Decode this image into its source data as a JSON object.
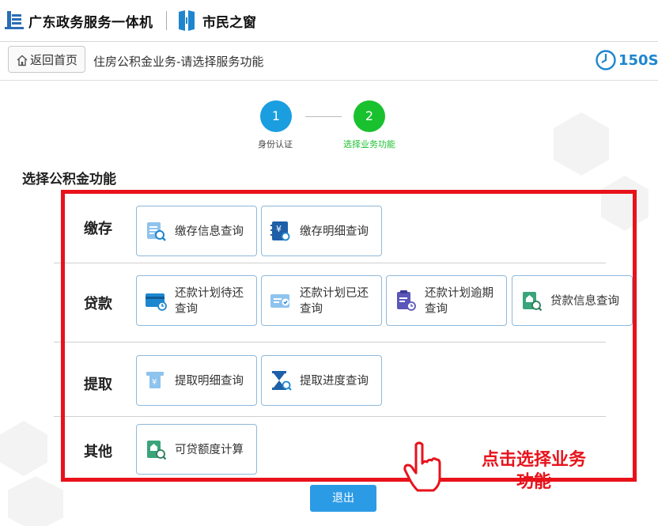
{
  "header": {
    "brand_primary": "广东政务服务一体机",
    "brand_secondary": "市民之窗"
  },
  "nav": {
    "back_label": "返回首页",
    "title": "住房公积金业务-请选择服务功能",
    "timer": "150S"
  },
  "steps": [
    {
      "number": "1",
      "label": "身份认证",
      "state": "done",
      "color": "#1a9ee0"
    },
    {
      "number": "2",
      "label": "选择业务功能",
      "state": "active",
      "color": "#19c12f"
    }
  ],
  "section_title": "选择公积金功能",
  "categories": [
    {
      "name": "缴存",
      "items": [
        "缴存信息查询",
        "缴存明细查询"
      ]
    },
    {
      "name": "贷款",
      "items": [
        "还款计划待还查询",
        "还款计划已还查询",
        "还款计划逾期查询",
        "贷款信息查询"
      ]
    },
    {
      "name": "提取",
      "items": [
        "提取明细查询",
        "提取进度查询"
      ]
    },
    {
      "name": "其他",
      "items": [
        "可贷额度计算"
      ]
    }
  ],
  "annotation": [
    "点击选择业务",
    "功能"
  ],
  "exit_label": "退出",
  "colors": {
    "accent": "#2c9be6",
    "highlight": "#e8121b",
    "step_done": "#1a9ee0",
    "step_active": "#19c12f"
  }
}
